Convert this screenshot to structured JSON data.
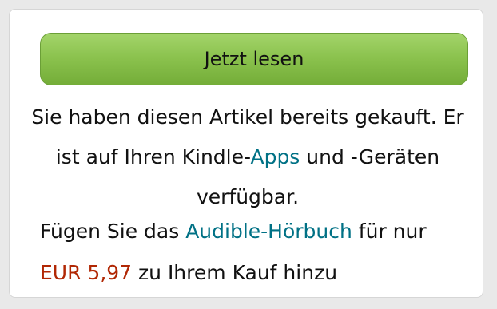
{
  "colors": {
    "page_background": "#e9e9e9",
    "panel_background": "#ffffff",
    "button_green": "#8cc34f",
    "link": "#007185",
    "price": "#b12704",
    "text": "#111111"
  },
  "read_now": {
    "label": "Jetzt lesen"
  },
  "ownership": {
    "text_before_link": "Sie haben diesen Artikel bereits gekauft. Er ist auf Ihren Kindle-",
    "apps_link": "Apps",
    "text_after_link": " und -Geräten verfügbar."
  },
  "audible_offer": {
    "prefix": "Fügen Sie das ",
    "audible_link": "Audible-Hörbuch",
    "middle": " für nur ",
    "price": "EUR 5,97",
    "suffix": " zu Ihrem Kauf hinzu"
  }
}
